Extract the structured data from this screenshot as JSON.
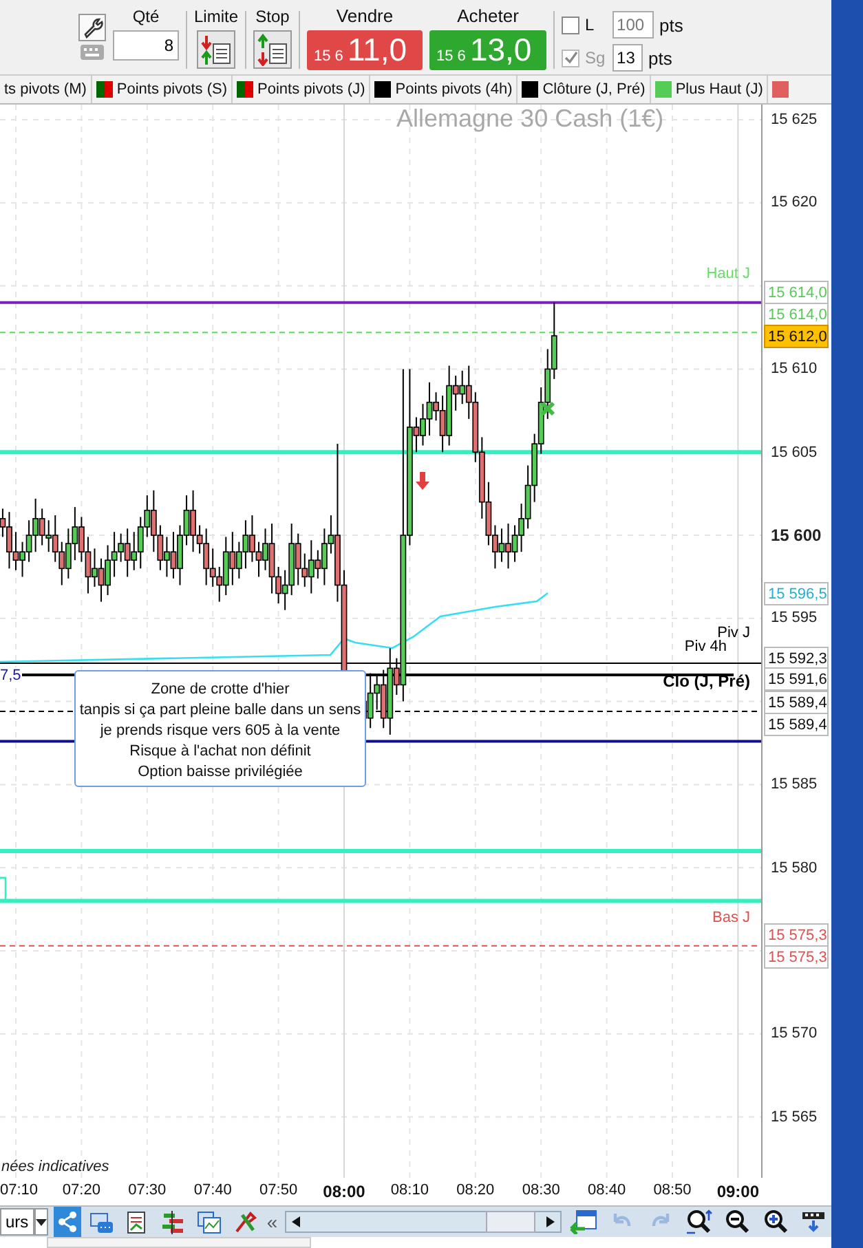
{
  "toolbar": {
    "quantity": {
      "label": "Qté",
      "value": "8"
    },
    "limit": {
      "label": "Limite"
    },
    "stop": {
      "label": "Stop"
    },
    "sell": {
      "label": "Vendre",
      "prefix": "15 6",
      "price": "11,0"
    },
    "buy": {
      "label": "Acheter",
      "prefix": "15 6",
      "price": "13,0"
    },
    "options": [
      {
        "label": "L",
        "checked": false,
        "disabled": false,
        "value": "100",
        "unit": "pts"
      },
      {
        "label": "Sg",
        "checked": true,
        "disabled": true,
        "value": "13",
        "unit": "pts"
      }
    ]
  },
  "indicator_tabs": [
    {
      "label": "ts pivots (M)"
    },
    {
      "label": "Points pivots (S)",
      "swatches": [
        {
          "color": "#006600"
        },
        {
          "color": "#dd0000"
        }
      ]
    },
    {
      "label": "Points pivots (J)",
      "swatches": [
        {
          "color": "#006600"
        },
        {
          "color": "#dd0000"
        }
      ]
    },
    {
      "label": "Points pivots (4h)",
      "swatches": [
        {
          "color": "#000000"
        }
      ]
    },
    {
      "label": "Clôture (J, Pré)",
      "swatches": [
        {
          "color": "#000000"
        }
      ]
    },
    {
      "label": "Plus Haut (J)",
      "swatches": [
        {
          "color": "#55cc55"
        }
      ]
    },
    {
      "swatches": [
        {
          "color": "#e06060"
        }
      ]
    }
  ],
  "chart": {
    "instrument": "Allemagne 30 Cash (1€)",
    "y_ticks": [
      {
        "label": "15 625",
        "major": false
      },
      {
        "label": "15 620",
        "major": false
      },
      {
        "label": "15 610",
        "major": false
      },
      {
        "label": "15 605",
        "major": false
      },
      {
        "label": "15 600",
        "major": true
      },
      {
        "label": "15 595",
        "major": false
      },
      {
        "label": "15 585",
        "major": false
      },
      {
        "label": "15 580",
        "major": false
      },
      {
        "label": "15 570",
        "major": false
      },
      {
        "label": "15 565",
        "major": false
      }
    ],
    "price_labels": [
      {
        "text": "15 614,0",
        "kind": "green"
      },
      {
        "text": "15 614,0",
        "kind": "green"
      },
      {
        "text": "15 612,0",
        "kind": "current"
      },
      {
        "text": "15 596,5",
        "kind": "cyan"
      },
      {
        "text": "15 592,3",
        "kind": "black"
      },
      {
        "text": "15 591,6",
        "kind": "black"
      },
      {
        "text": "15 589,4",
        "kind": "black"
      },
      {
        "text": "15 589,4",
        "kind": "black"
      },
      {
        "text": "15 575,3",
        "kind": "red"
      },
      {
        "text": "15 575,3",
        "kind": "red"
      }
    ],
    "line_labels": [
      {
        "text": "Haut J",
        "color": "#66dd66",
        "bold": false
      },
      {
        "text": "Piv J",
        "color": "#000000",
        "bold": false
      },
      {
        "text": "Piv 4h",
        "color": "#000000",
        "bold": false
      },
      {
        "text": "Clo (J, Pré)",
        "color": "#000000",
        "bold": true
      },
      {
        "text": "Bas J",
        "color": "#e05050",
        "bold": false
      },
      {
        "text": "7,5",
        "color": "#1a1aa0",
        "bold": false
      }
    ],
    "note": [
      "Zone de crotte d'hier",
      "tanpis si ça part pleine balle dans un sens",
      "je prends risque vers 605 à la vente",
      "Risque à l'achat non définit",
      "Option baisse privilégiée"
    ],
    "disclaimer": "nées indicatives",
    "x_ticks": [
      {
        "label": "07:10",
        "major": false
      },
      {
        "label": "07:20",
        "major": false
      },
      {
        "label": "07:30",
        "major": false
      },
      {
        "label": "07:40",
        "major": false
      },
      {
        "label": "07:50",
        "major": false
      },
      {
        "label": "08:00",
        "major": true
      },
      {
        "label": "08:10",
        "major": false
      },
      {
        "label": "08:20",
        "major": false
      },
      {
        "label": "08:30",
        "major": false
      },
      {
        "label": "08:40",
        "major": false
      },
      {
        "label": "08:50",
        "major": false
      },
      {
        "label": "09:00",
        "major": true
      }
    ]
  },
  "bottom_toolbar": {
    "period_button": "urs",
    "scroll_left": "«"
  }
}
